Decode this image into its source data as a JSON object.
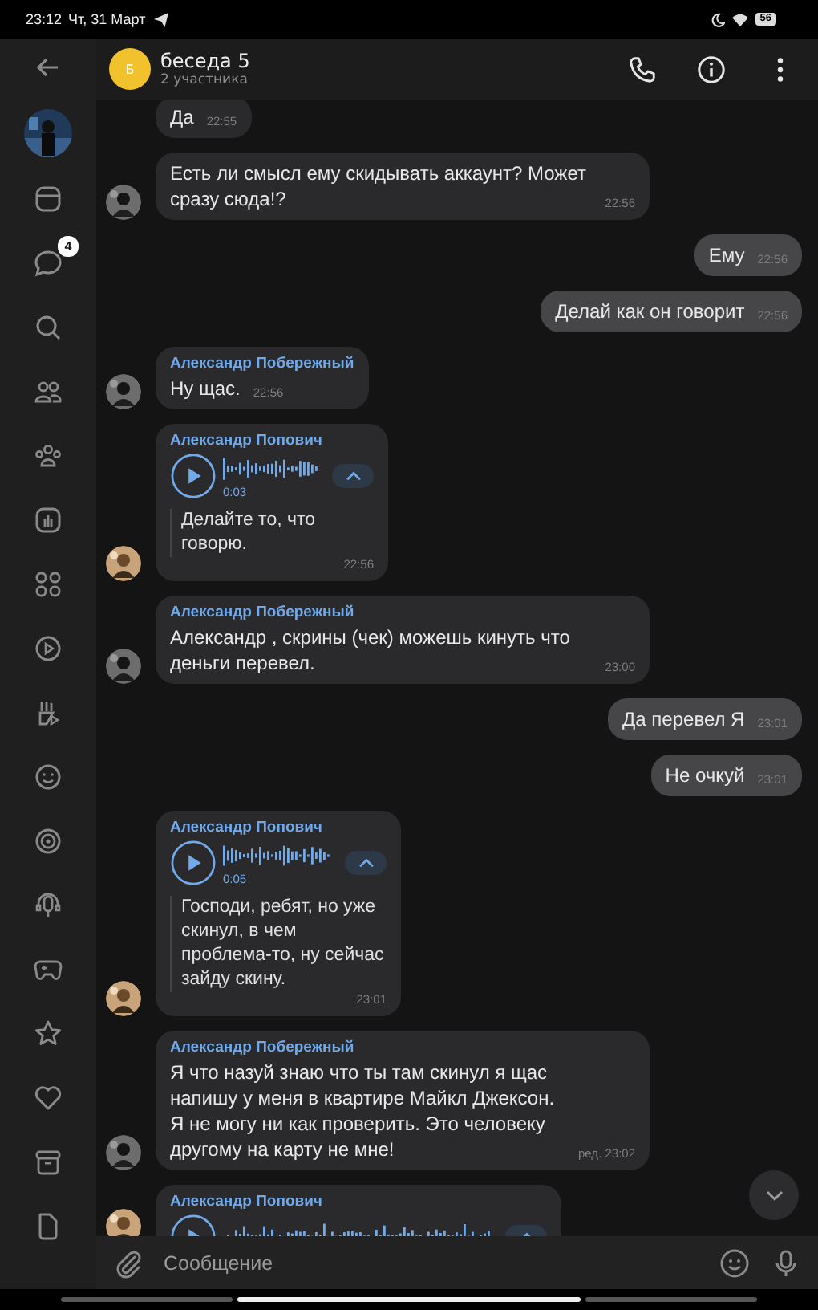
{
  "status_bar": {
    "time": "23:12",
    "date": "Чт, 31 Март",
    "battery": "56"
  },
  "sidebar": {
    "chats_badge": "4"
  },
  "header": {
    "avatar_letter": "Б",
    "title": "беседа 5",
    "subtitle": "2 участника"
  },
  "messages": [
    {
      "kind": "text",
      "outgoing": false,
      "avatar": false,
      "text": "Да",
      "time": "22:55"
    },
    {
      "kind": "text",
      "outgoing": false,
      "avatar": true,
      "text": "Есть ли смысл ему скидывать аккаунт? Может сразу сюда!?",
      "time": "22:56"
    },
    {
      "kind": "text",
      "outgoing": true,
      "text": "Ему",
      "time": "22:56"
    },
    {
      "kind": "text",
      "outgoing": true,
      "text": "Делай как он говорит",
      "time": "22:56"
    },
    {
      "kind": "text",
      "outgoing": false,
      "avatar": true,
      "author": "Александр Побережный",
      "text": "Ну щас.",
      "time": "22:56"
    },
    {
      "kind": "voice",
      "outgoing": false,
      "avatar": true,
      "author": "Александр Попович",
      "duration": "0:03",
      "transcript": "Делайте то, что говорю.",
      "time": "22:56"
    },
    {
      "kind": "text",
      "outgoing": false,
      "avatar": true,
      "author": "Александр Побережный",
      "text": "Александр , скрины (чек) можешь кинуть что деньги перевел.",
      "time": "23:00"
    },
    {
      "kind": "text",
      "outgoing": true,
      "text": "Да перевел Я",
      "time": "23:01"
    },
    {
      "kind": "text",
      "outgoing": true,
      "text": "Не очкуй",
      "time": "23:01"
    },
    {
      "kind": "voice",
      "outgoing": false,
      "avatar": true,
      "author": "Александр Попович",
      "duration": "0:05",
      "transcript": "Господи, ребят, но уже скинул, в чем проблема-то, ну сейчас зайду скину.",
      "time": "23:01"
    },
    {
      "kind": "text",
      "outgoing": false,
      "avatar": true,
      "author": "Александр Побережный",
      "text": "Я что назуй знаю что ты там скинул я щас напишу у меня в квартире Майкл Джексон. Я не могу ни как проверить. Это человеку другому на карту не мне!",
      "time": "ред. 23:02"
    },
    {
      "kind": "voice",
      "outgoing": false,
      "avatar": true,
      "author": "Александр Попович"
    }
  ],
  "composer": {
    "placeholder": "Сообщение"
  }
}
